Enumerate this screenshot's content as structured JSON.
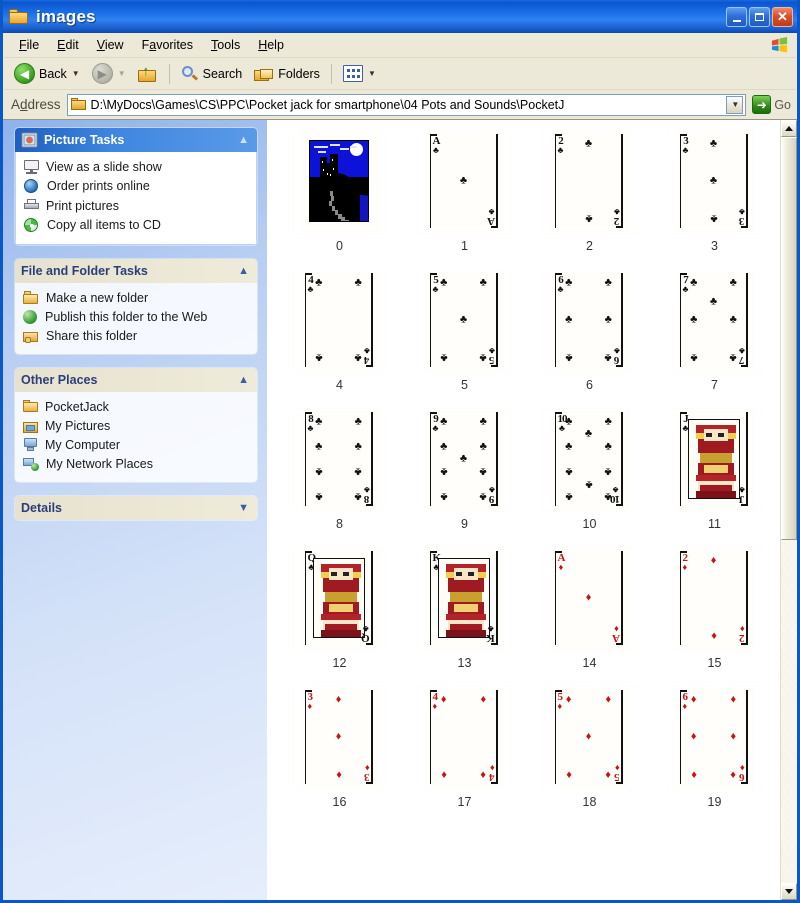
{
  "window": {
    "title": "images",
    "folder_icon": "folder-open-icon",
    "controls": {
      "minimize": "Minimize",
      "maximize": "Maximize",
      "close": "Close"
    }
  },
  "menubar": {
    "items": [
      {
        "label": "File",
        "accel": "F"
      },
      {
        "label": "Edit",
        "accel": "E"
      },
      {
        "label": "View",
        "accel": "V"
      },
      {
        "label": "Favorites",
        "accel": "a"
      },
      {
        "label": "Tools",
        "accel": "T"
      },
      {
        "label": "Help",
        "accel": "H"
      }
    ],
    "brand_icon": "windows-flag-icon"
  },
  "toolbar": {
    "back_label": "Back",
    "back_icon": "back-arrow-icon",
    "forward_icon": "forward-arrow-icon",
    "up_icon": "up-folder-icon",
    "search_label": "Search",
    "search_icon": "magnifier-icon",
    "folders_label": "Folders",
    "folders_icon": "folders-icon",
    "views_icon": "views-icon",
    "dropdown_icon": "chevron-down-icon"
  },
  "address": {
    "label": "Address",
    "accel": "d",
    "value": "D:\\MyDocs\\Games\\CS\\PPC\\Pocket jack for smartphone\\04 Pots and Sounds\\PocketJ",
    "folder_icon": "folder-icon",
    "dropdown_icon": "chevron-down-icon",
    "go_label": "Go",
    "go_icon": "go-arrow-icon"
  },
  "sidebar": {
    "panels": [
      {
        "title": "Picture Tasks",
        "style": "blue",
        "collapse_icon": "chevron-up-icon",
        "header_icon": "picture-tasks-icon",
        "items": [
          {
            "label": "View as a slide show",
            "icon": "slideshow-icon"
          },
          {
            "label": "Order prints online",
            "icon": "order-prints-icon"
          },
          {
            "label": "Print pictures",
            "icon": "printer-icon"
          },
          {
            "label": "Copy all items to CD",
            "icon": "burn-cd-icon"
          }
        ]
      },
      {
        "title": "File and Folder Tasks",
        "style": "tan",
        "collapse_icon": "chevron-up-icon",
        "items": [
          {
            "label": "Make a new folder",
            "icon": "new-folder-icon"
          },
          {
            "label": "Publish this folder to the Web",
            "icon": "publish-web-icon"
          },
          {
            "label": "Share this folder",
            "icon": "share-folder-icon"
          }
        ]
      },
      {
        "title": "Other Places",
        "style": "tan",
        "collapse_icon": "chevron-up-icon",
        "items": [
          {
            "label": "PocketJack",
            "icon": "folder-icon"
          },
          {
            "label": "My Pictures",
            "icon": "my-pictures-icon"
          },
          {
            "label": "My Computer",
            "icon": "my-computer-icon"
          },
          {
            "label": "My Network Places",
            "icon": "my-network-places-icon"
          }
        ]
      },
      {
        "title": "Details",
        "style": "tan",
        "collapse_icon": "chevron-down-icon",
        "items": []
      }
    ]
  },
  "content": {
    "view_mode": "thumbnails",
    "files": [
      {
        "label": "0",
        "kind": "back",
        "rank": "",
        "suit": "",
        "count": 0
      },
      {
        "label": "1",
        "kind": "pip",
        "rank": "A",
        "suit": "clubs",
        "count": 1
      },
      {
        "label": "2",
        "kind": "pip",
        "rank": "2",
        "suit": "clubs",
        "count": 2
      },
      {
        "label": "3",
        "kind": "pip",
        "rank": "3",
        "suit": "clubs",
        "count": 3
      },
      {
        "label": "4",
        "kind": "pip",
        "rank": "4",
        "suit": "clubs",
        "count": 4
      },
      {
        "label": "5",
        "kind": "pip",
        "rank": "5",
        "suit": "clubs",
        "count": 5
      },
      {
        "label": "6",
        "kind": "pip",
        "rank": "6",
        "suit": "clubs",
        "count": 6
      },
      {
        "label": "7",
        "kind": "pip",
        "rank": "7",
        "suit": "clubs",
        "count": 7
      },
      {
        "label": "8",
        "kind": "pip",
        "rank": "8",
        "suit": "clubs",
        "count": 8
      },
      {
        "label": "9",
        "kind": "pip",
        "rank": "9",
        "suit": "clubs",
        "count": 9
      },
      {
        "label": "10",
        "kind": "pip",
        "rank": "10",
        "suit": "clubs",
        "count": 10
      },
      {
        "label": "11",
        "kind": "court",
        "rank": "J",
        "suit": "clubs",
        "count": 0
      },
      {
        "label": "12",
        "kind": "court",
        "rank": "Q",
        "suit": "clubs",
        "count": 0
      },
      {
        "label": "13",
        "kind": "court",
        "rank": "K",
        "suit": "clubs",
        "count": 0
      },
      {
        "label": "14",
        "kind": "pip",
        "rank": "A",
        "suit": "diamonds",
        "count": 1
      },
      {
        "label": "15",
        "kind": "pip",
        "rank": "2",
        "suit": "diamonds",
        "count": 2
      },
      {
        "label": "16",
        "kind": "pip",
        "rank": "3",
        "suit": "diamonds",
        "count": 3
      },
      {
        "label": "17",
        "kind": "pip",
        "rank": "4",
        "suit": "diamonds",
        "count": 4
      },
      {
        "label": "18",
        "kind": "pip",
        "rank": "5",
        "suit": "diamonds",
        "count": 5
      },
      {
        "label": "19",
        "kind": "pip",
        "rank": "6",
        "suit": "diamonds",
        "count": 6
      }
    ]
  },
  "scrollbar": {
    "up_icon": "scroll-up-icon",
    "down_icon": "scroll-down-icon",
    "thumb_position_percent": 0,
    "thumb_size_percent": 54
  },
  "colors": {
    "titlebar_blue": "#0a56d0",
    "chrome_tan": "#ece9d8",
    "sidebar_blue": "#b7cdf2",
    "club_black": "#101010",
    "diamond_red": "#cc1111",
    "card_back_blue": "#0c12d8"
  }
}
